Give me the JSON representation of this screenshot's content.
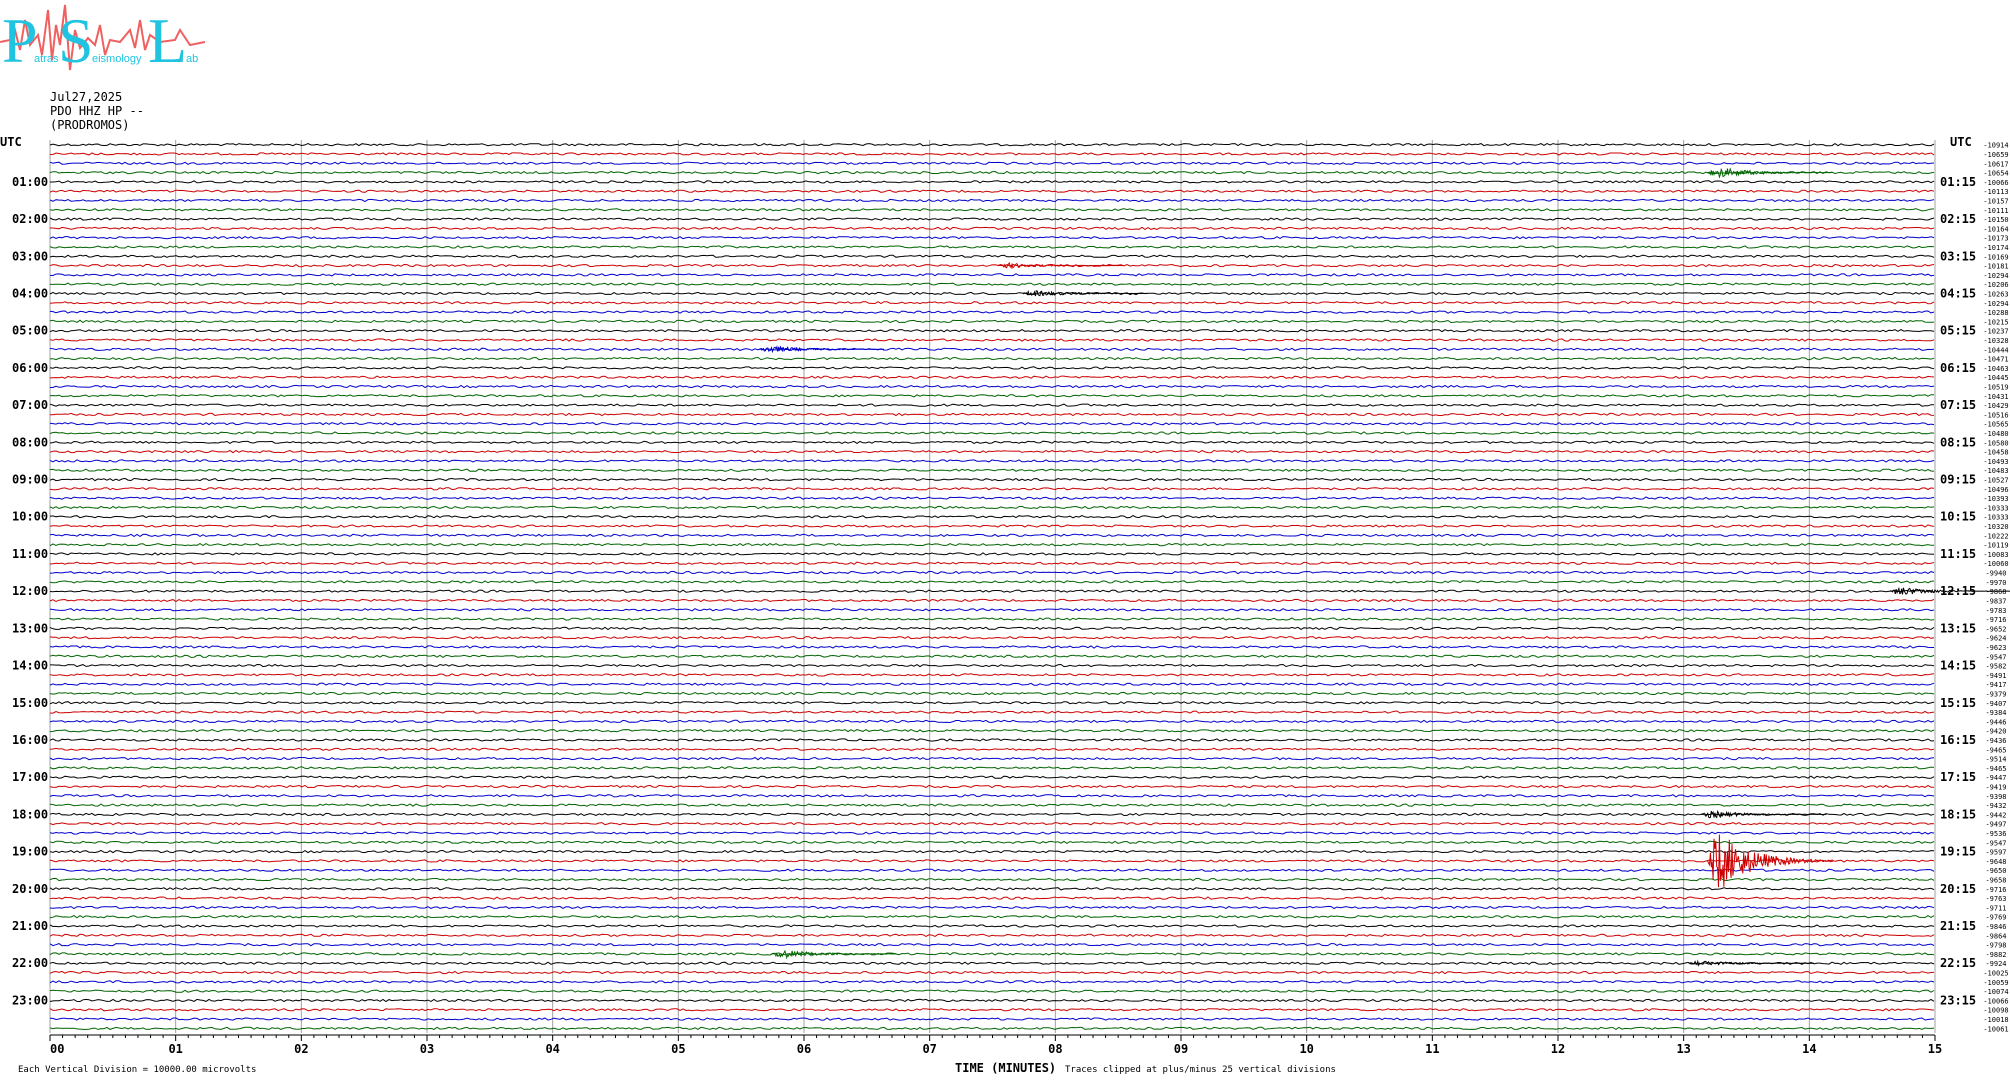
{
  "header": {
    "date": "Jul27,2025",
    "channel": "PDO HHZ HP --",
    "station": "(PRODROMOS)"
  },
  "logo": {
    "letters": [
      "P",
      "S",
      "L"
    ],
    "small_words": [
      "atras",
      "eismology",
      "ab"
    ],
    "color_letters": "#20c4e0",
    "color_wave": "#f06060"
  },
  "footer": {
    "left_note": "Each Vertical Division = 10000.00 microvolts",
    "xaxis_title": "TIME (MINUTES)",
    "clip_note": "Traces clipped at plus/minus 25 vertical divisions"
  },
  "chart_data": {
    "type": "line",
    "xlabel": "TIME (MINUTES)",
    "xlim": [
      0,
      15
    ],
    "x_ticks": [
      "00",
      "01",
      "02",
      "03",
      "04",
      "05",
      "06",
      "07",
      "08",
      "09",
      "10",
      "11",
      "12",
      "13",
      "14",
      "15"
    ],
    "left_axis_title": "UTC",
    "right_axis_title": "UTC",
    "left_hour_labels": [
      "01:00",
      "02:00",
      "03:00",
      "04:00",
      "05:00",
      "06:00",
      "07:00",
      "08:00",
      "09:00",
      "10:00",
      "11:00",
      "12:00",
      "13:00",
      "14:00",
      "15:00",
      "16:00",
      "17:00",
      "18:00",
      "19:00",
      "20:00",
      "21:00",
      "22:00",
      "23:00"
    ],
    "right_hour_labels": [
      "01:15",
      "02:15",
      "03:15",
      "04:15",
      "05:15",
      "06:15",
      "07:15",
      "08:15",
      "09:15",
      "10:15",
      "11:15",
      "12:15",
      "13:15",
      "14:15",
      "15:15",
      "16:15",
      "17:15",
      "18:15",
      "19:15",
      "20:15",
      "21:15",
      "22:15",
      "23:15"
    ],
    "trace_colors": [
      "#000000",
      "#cc0000",
      "#0000cc",
      "#006400"
    ],
    "traces_per_hour": 4,
    "trace_count": 96,
    "offsets": [
      "-10914",
      "-10659",
      "-10617",
      "-10654",
      "-10066",
      "-10113",
      "-10157",
      "-10111",
      "-10150",
      "-10164",
      "-10173",
      "-10174",
      "-10169",
      "-10181",
      "-10294",
      "-10206",
      "-10263",
      "-10294",
      "-10288",
      "-10215",
      "-10237",
      "-10328",
      "-10444",
      "-10471",
      "-10463",
      "-10445",
      "-10519",
      "-10431",
      "-10429",
      "-10516",
      "-10565",
      "-10480",
      "-10580",
      "-10458",
      "-10493",
      "-10483",
      "-10527",
      "-10496",
      "-10393",
      "-10333",
      "-10333",
      "-10320",
      "-10222",
      "-10119",
      "-10083",
      "-10060",
      "-9940",
      "-9970",
      "-9868",
      "-9837",
      "-9783",
      "-9716",
      "-9652",
      "-9624",
      "-9623",
      "-9547",
      "-9582",
      "-9491",
      "-9417",
      "-9379",
      "-9407",
      "-9384",
      "-9446",
      "-9420",
      "-9436",
      "-9465",
      "-9514",
      "-9465",
      "-9447",
      "-9419",
      "-9398",
      "-9432",
      "-9442",
      "-9497",
      "-9536",
      "-9547",
      "-9597",
      "-9648",
      "-9650",
      "-9658",
      "-9716",
      "-9763",
      "-9711",
      "-9769",
      "-9846",
      "-9864",
      "-9798",
      "-9882",
      "-9924",
      "-10025",
      "-10059",
      "-10074",
      "-10066",
      "-10098",
      "-10018",
      "-10061"
    ],
    "events": [
      {
        "trace": 3,
        "minute": 13.35,
        "amplitude": 0.6
      },
      {
        "trace": 16,
        "minute": 7.9,
        "amplitude": 0.35
      },
      {
        "trace": 13,
        "minute": 7.7,
        "amplitude": 0.3
      },
      {
        "trace": 22,
        "minute": 5.8,
        "amplitude": 0.4
      },
      {
        "trace": 48,
        "minute": 14.8,
        "amplitude": 0.5
      },
      {
        "trace": 72,
        "minute": 13.3,
        "amplitude": 0.4
      },
      {
        "trace": 77,
        "minute": 13.35,
        "amplitude": 3.5
      },
      {
        "trace": 87,
        "minute": 5.9,
        "amplitude": 0.5
      },
      {
        "trace": 88,
        "minute": 13.2,
        "amplitude": 0.3
      }
    ]
  }
}
